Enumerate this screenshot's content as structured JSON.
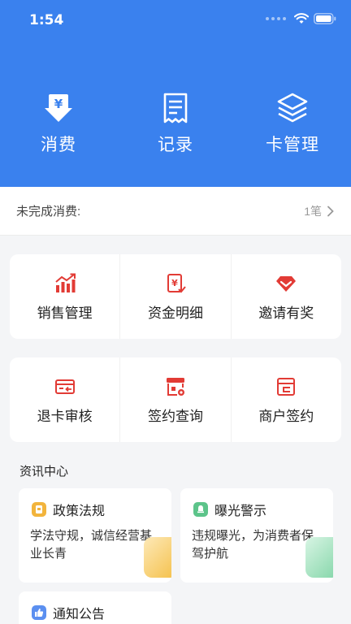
{
  "status_bar": {
    "time": "1:54"
  },
  "top_actions": [
    {
      "label": "消费",
      "icon": "yuan-arrow-icon"
    },
    {
      "label": "记录",
      "icon": "receipt-icon"
    },
    {
      "label": "卡管理",
      "icon": "layers-icon"
    }
  ],
  "pending": {
    "label": "未完成消费:",
    "count": "1笔"
  },
  "grid_row1": [
    {
      "label": "销售管理",
      "icon": "sales-chart-icon"
    },
    {
      "label": "资金明细",
      "icon": "funds-detail-icon"
    },
    {
      "label": "邀请有奖",
      "icon": "gem-reward-icon"
    }
  ],
  "grid_row2": [
    {
      "label": "退卡审核",
      "icon": "card-return-icon"
    },
    {
      "label": "签约查询",
      "icon": "store-query-icon"
    },
    {
      "label": "商户签约",
      "icon": "merchant-sign-icon"
    }
  ],
  "news": {
    "title": "资讯中心",
    "items": [
      {
        "title": "政策法规",
        "desc": "学法守规，诚信经营基业长青",
        "icon": "policy-icon",
        "color": "#f2b43c"
      },
      {
        "title": "曝光警示",
        "desc": "违规曝光，为消费者保驾护航",
        "icon": "alert-bell-icon",
        "color": "#5cc48a"
      },
      {
        "title": "通知公告",
        "desc": "",
        "icon": "thumb-notice-icon",
        "color": "#5b8ff0"
      }
    ]
  },
  "colors": {
    "header_bg": "#3a81ee",
    "accent_red": "#e23b35",
    "page_bg": "#f4f5f7"
  }
}
